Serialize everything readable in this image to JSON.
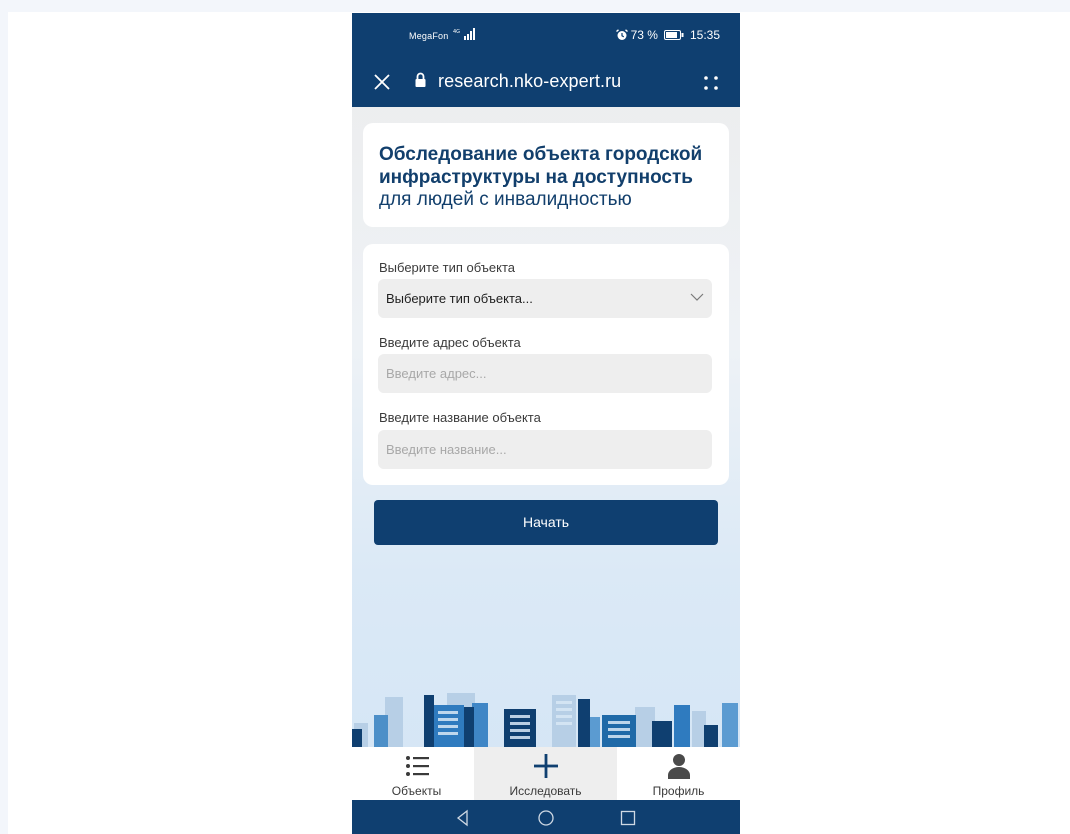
{
  "status_bar": {
    "carrier": "MegaFon",
    "battery": "73 %",
    "time": "15:35"
  },
  "browser": {
    "url": "research.nko-expert.ru"
  },
  "header": {
    "title_bold": "Обследование объекта городской инфраструктуры на доступность",
    "title_sub": "для людей с инвалидностью"
  },
  "form": {
    "type_label": "Выберите тип объекта",
    "type_value": "Выберите тип объекта...",
    "address_label": "Введите адрес объекта",
    "address_placeholder": "Введите адрес...",
    "name_label": "Введите название объекта",
    "name_placeholder": "Введите название..."
  },
  "start_button": "Начать",
  "bottom_nav": {
    "items": [
      {
        "label": "Объекты",
        "icon": "list-icon"
      },
      {
        "label": "Исследовать",
        "icon": "plus-icon",
        "active": true
      },
      {
        "label": "Профиль",
        "icon": "person-icon"
      }
    ]
  },
  "colors": {
    "primary": "#0f3f70",
    "title_text": "#123f6c",
    "field_bg": "#eeeeee"
  }
}
